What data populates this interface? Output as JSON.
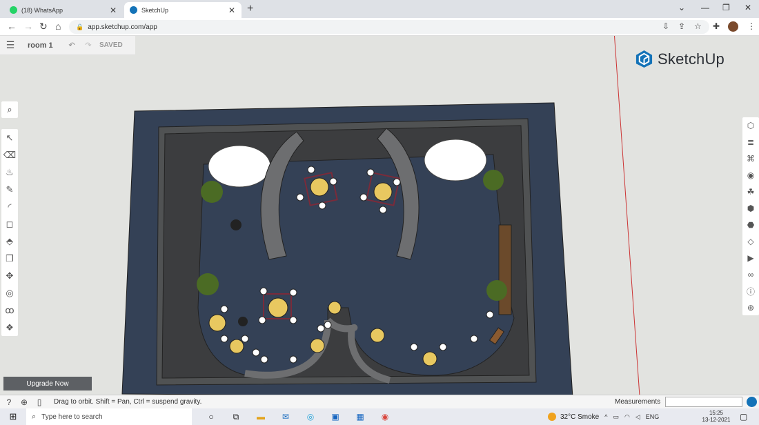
{
  "browser": {
    "tabs": [
      {
        "title": "(18) WhatsApp",
        "favicon_color": "#25d366"
      },
      {
        "title": "SketchUp",
        "favicon_color": "#1473b8"
      }
    ],
    "new_tab_icon": "plus-icon",
    "url": "app.sketchup.com/app"
  },
  "app": {
    "model_name": "room 1",
    "save_status": "SAVED",
    "logo_text": "SketchUp",
    "upgrade_label": "Upgrade Now",
    "status_hint": "Drag to orbit. Shift = Pan, Ctrl = suspend gravity.",
    "measurements_label": "Measurements",
    "measurements_value": "",
    "left_tools": [
      "select-icon",
      "eraser-icon",
      "paint-bucket-icon",
      "pencil-icon",
      "arc-icon",
      "rectangle-icon",
      "push-pull-icon",
      "offset-icon",
      "move-icon",
      "tape-measure-icon",
      "footprint-icon",
      "orbit-icon"
    ],
    "right_tools": [
      "entity-info-icon",
      "instructor-icon",
      "styles-icon",
      "materials-icon",
      "components-icon",
      "scenes-icon",
      "outliner-icon",
      "tags-icon",
      "animation-icon",
      "display-icon",
      "info-icon",
      "extension-icon"
    ]
  },
  "taskbar": {
    "search_placeholder": "Type here to search",
    "weather": "32°C  Smoke",
    "language": "ENG",
    "time": "15:25",
    "date": "13-12-2021"
  },
  "colors": {
    "floor": "#344156",
    "walls": "#3c3d3f",
    "accent": "#1473b8"
  }
}
